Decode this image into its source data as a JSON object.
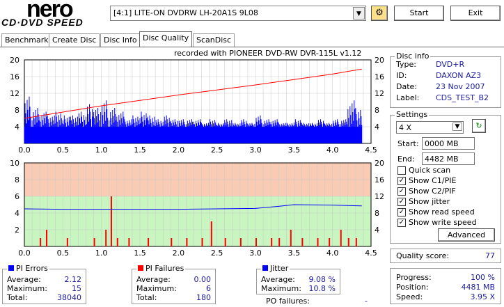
{
  "app": {
    "logo_main": "nero",
    "logo_sub": "CD·DVD SPEED",
    "drive": "[4:1]  LITE-ON DVDRW LH-20A1S 9L08",
    "start": "Start",
    "exit": "Exit"
  },
  "tabs": [
    {
      "label": "Benchmark"
    },
    {
      "label": "Create Disc"
    },
    {
      "label": "Disc Info"
    },
    {
      "label": "Disc Quality",
      "active": true
    },
    {
      "label": "ScanDisc"
    }
  ],
  "chart_caption": "recorded with PIONEER DVD-RW  DVR-115L v1.12",
  "disc_info": {
    "title": "Disc info",
    "type_label": "Type:",
    "type": "DVD+R",
    "id_label": "ID:",
    "id": "DAXON AZ3",
    "date_label": "Date:",
    "date": "23 Nov 2007",
    "label_label": "Label:",
    "label": "CDS_TEST_B2"
  },
  "settings": {
    "title": "Settings",
    "speed": "4 X",
    "start_label": "Start:",
    "start": "0000 MB",
    "end_label": "End:",
    "end": "4482 MB",
    "quick_scan": "Quick scan",
    "show_c1": "Show C1/PIE",
    "show_c2": "Show C2/PIF",
    "show_jitter": "Show jitter",
    "show_read": "Show read speed",
    "show_write": "Show write speed",
    "checks": [
      false,
      true,
      true,
      true,
      true,
      true
    ],
    "advanced": "Advanced"
  },
  "quality": {
    "label": "Quality score:",
    "value": "77"
  },
  "progress": {
    "progress_label": "Progress:",
    "progress": "100 %",
    "position_label": "Position:",
    "position": "4481 MB",
    "speed_label": "Speed:",
    "speed": "3.95 X"
  },
  "pi_errors": {
    "title": "PI Errors",
    "avg_label": "Average:",
    "avg": "2.12",
    "max_label": "Maximum:",
    "max": "15",
    "total_label": "Total:",
    "total": "38040",
    "color": "#0000ff"
  },
  "pi_failures": {
    "title": "PI Failures",
    "avg_label": "Average:",
    "avg": "0.00",
    "max_label": "Maximum:",
    "max": "6",
    "total_label": "Total:",
    "total": "180",
    "color": "#ff0000"
  },
  "jitter": {
    "title": "Jitter",
    "avg_label": "Average:",
    "avg": "9.08 %",
    "max_label": "Maximum:",
    "max": "10.8 %",
    "po_label": "PO failures:",
    "po": "-",
    "color": "#0000ff"
  },
  "chart_data": [
    {
      "type": "bar+line",
      "xlim": [
        0,
        4.5
      ],
      "ylim_left": [
        0,
        20
      ],
      "ylim_right": [
        0,
        20
      ],
      "x_ticks": [
        "0.0",
        "0.5",
        "1.0",
        "1.5",
        "2.0",
        "2.5",
        "3.0",
        "3.5",
        "4.0",
        "4.5"
      ],
      "y_ticks_left": [
        "4",
        "8",
        "12",
        "16",
        "20"
      ],
      "y_ticks_right": [
        "4",
        "8",
        "12",
        "16",
        "20"
      ],
      "pi_errors_x": [
        0,
        0.1,
        0.2,
        0.3,
        0.4,
        0.5,
        0.6,
        0.7,
        0.8,
        0.9,
        1.0,
        1.1,
        1.2,
        1.3,
        1.4,
        1.5,
        1.6,
        1.7,
        1.8,
        1.9,
        2.0,
        2.1,
        2.2,
        2.3,
        2.4,
        2.5,
        2.6,
        2.7,
        2.8,
        2.9,
        3.0,
        3.1,
        3.2,
        3.3,
        3.4,
        3.5,
        3.6,
        3.7,
        3.8,
        3.9,
        4.0,
        4.1,
        4.2,
        4.3,
        4.38
      ],
      "pi_errors": [
        12,
        9,
        8,
        7,
        8,
        7,
        7,
        8,
        10,
        9,
        11,
        9,
        8,
        6,
        7,
        8,
        7,
        6,
        7,
        6,
        6,
        6,
        6,
        5,
        6,
        5,
        6,
        5,
        6,
        5,
        7,
        6,
        6,
        5,
        5,
        6,
        5,
        5,
        6,
        5,
        6,
        6,
        11,
        9,
        6
      ],
      "pi_baseline": 4,
      "read_speed_x": [
        0,
        0.5,
        1.0,
        1.5,
        2.0,
        2.5,
        3.0,
        3.5,
        4.0,
        4.38
      ],
      "read_speed": [
        6,
        7.5,
        9,
        10.3,
        11.6,
        12.8,
        14,
        15.3,
        16.6,
        17.8
      ]
    },
    {
      "type": "bar+line",
      "xlim": [
        0,
        4.5
      ],
      "ylim_left": [
        0,
        10
      ],
      "ylim_right": [
        0,
        20
      ],
      "x_ticks": [
        "0.0",
        "0.5",
        "1.0",
        "1.5",
        "2.0",
        "2.5",
        "3.0",
        "3.5",
        "4.0",
        "4.5"
      ],
      "y_ticks_left": [
        "2",
        "4",
        "6",
        "8",
        "10"
      ],
      "y_ticks_right": [
        "4",
        "8",
        "12",
        "16",
        "20"
      ],
      "pi_failures": [
        [
          0.2,
          1
        ],
        [
          0.28,
          2
        ],
        [
          0.55,
          1
        ],
        [
          0.9,
          1
        ],
        [
          1.05,
          2
        ],
        [
          1.12,
          6
        ],
        [
          1.2,
          1
        ],
        [
          1.35,
          1
        ],
        [
          1.6,
          1
        ],
        [
          1.9,
          1
        ],
        [
          2.1,
          1
        ],
        [
          2.3,
          1
        ],
        [
          2.42,
          3
        ],
        [
          2.6,
          1
        ],
        [
          2.8,
          1
        ],
        [
          3.0,
          1
        ],
        [
          3.2,
          1
        ],
        [
          3.3,
          1
        ],
        [
          3.45,
          2
        ],
        [
          3.6,
          1
        ],
        [
          3.8,
          1
        ],
        [
          3.95,
          1
        ],
        [
          4.1,
          2
        ],
        [
          4.2,
          1
        ],
        [
          4.3,
          1
        ]
      ],
      "jitter_x": [
        0,
        0.5,
        1.0,
        1.5,
        2.0,
        2.5,
        3.0,
        3.3,
        3.5,
        4.0,
        4.38
      ],
      "jitter": [
        9.0,
        8.9,
        8.9,
        8.9,
        8.9,
        9.0,
        9.1,
        9.6,
        10.0,
        9.9,
        9.7
      ]
    }
  ]
}
